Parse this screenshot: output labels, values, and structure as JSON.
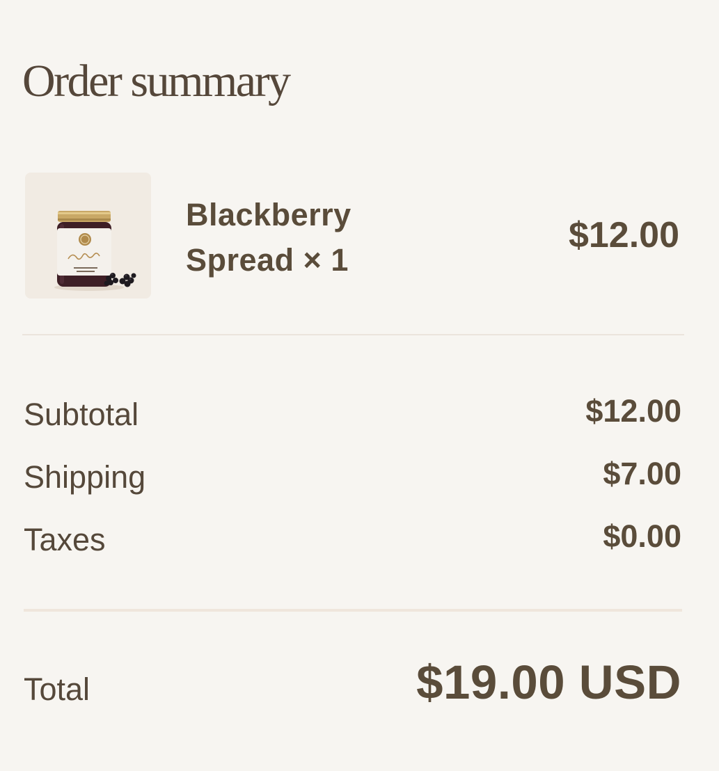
{
  "header": {
    "title": "Order summary"
  },
  "line_item": {
    "product_image": "blackberry-spread-jar-image",
    "name_line1": "Blackberry",
    "name_line2": "Spread × 1",
    "price": "$12.00"
  },
  "summary": {
    "rows": [
      {
        "label": "Subtotal",
        "value": "$12.00"
      },
      {
        "label": "Shipping",
        "value": "$7.00"
      },
      {
        "label": "Taxes",
        "value": "$0.00"
      }
    ]
  },
  "total": {
    "label": "Total",
    "value": "$19.00 USD"
  },
  "colors": {
    "background": "#f7f5f1",
    "text": "#5a4c3a",
    "divider": "#ebe4dc",
    "thumbnail_bg": "#f1ebe3"
  }
}
